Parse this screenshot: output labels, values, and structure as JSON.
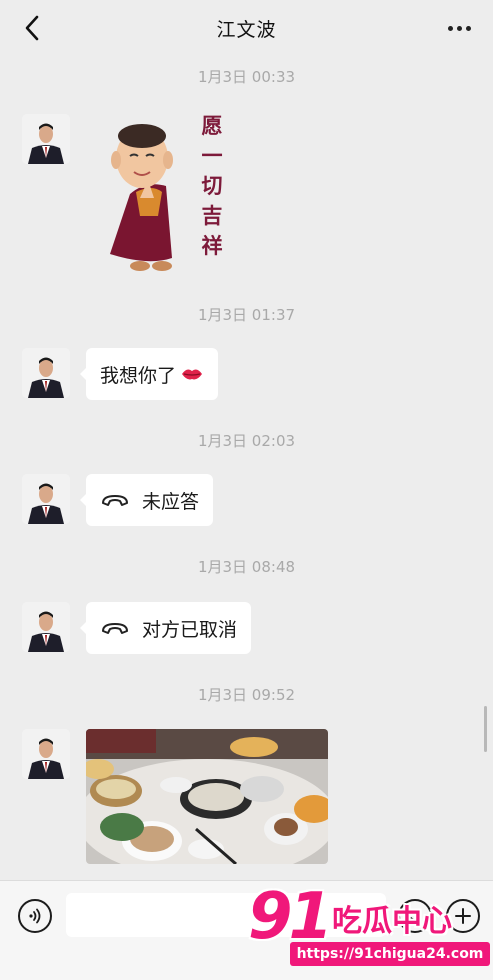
{
  "header": {
    "title": "江文波",
    "back_icon": "chevron-left-icon",
    "more_icon": "more-dots-icon"
  },
  "messages": [
    {
      "time": "1月3日 00:33",
      "type": "sticker",
      "sticker_text": [
        "愿",
        "一",
        "切",
        "吉",
        "祥"
      ]
    },
    {
      "time": "1月3日 01:37",
      "type": "text",
      "text": "我想你了",
      "emoji": "kiss-lips-icon"
    },
    {
      "time": "1月3日 02:03",
      "type": "call",
      "text": "未应答",
      "icon": "phone-hangup-icon"
    },
    {
      "time": "1月3日 08:48",
      "type": "call",
      "text": "对方已取消",
      "icon": "phone-hangup-icon"
    },
    {
      "time": "1月3日 09:52",
      "type": "image"
    }
  ],
  "input_bar": {
    "voice_icon": "voice-icon",
    "emoji_icon": "emoji-icon",
    "plus_icon": "plus-icon"
  },
  "watermark": {
    "number": "91",
    "text": "吃瓜中心",
    "url": "https://91chigua24.com"
  },
  "colors": {
    "background": "#ededed",
    "bubble": "#ffffff",
    "watermark": "#f0187a"
  }
}
